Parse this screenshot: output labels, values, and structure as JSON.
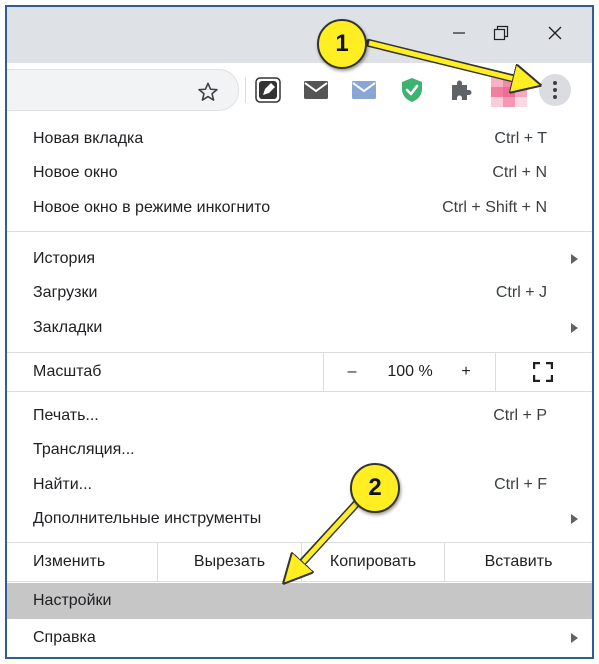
{
  "window": {
    "minimize_icon": "minimize-icon",
    "restore_icon": "restore-icon",
    "close_icon": "close-icon"
  },
  "toolbar": {
    "bookmark_icon": "star-icon",
    "extensions": [
      "pen-extension-icon",
      "gmail-dark-icon",
      "mail-blue-icon",
      "shield-check-icon",
      "puzzle-icon"
    ],
    "menu_icon": "three-dots-vertical-icon"
  },
  "menu": {
    "group1": [
      {
        "label": "Новая вкладка",
        "shortcut": "Ctrl + T"
      },
      {
        "label": "Новое окно",
        "shortcut": "Ctrl + N"
      },
      {
        "label": "Новое окно в режиме инкогнито",
        "shortcut": "Ctrl + Shift + N"
      }
    ],
    "group2": [
      {
        "label": "История",
        "shortcut": ""
      },
      {
        "label": "Загрузки",
        "shortcut": "Ctrl + J"
      },
      {
        "label": "Закладки",
        "shortcut": ""
      }
    ],
    "zoom": {
      "label": "Масштаб",
      "minus": "–",
      "value": "100 %",
      "plus": "+",
      "fullscreen_icon": "fullscreen-icon"
    },
    "group3": [
      {
        "label": "Печать...",
        "shortcut": "Ctrl + P"
      },
      {
        "label": "Трансляция...",
        "shortcut": ""
      },
      {
        "label": "Найти...",
        "shortcut": "Ctrl + F"
      },
      {
        "label": "Дополнительные инструменты",
        "shortcut": ""
      }
    ],
    "edit": {
      "label": "Изменить",
      "cut": "Вырезать",
      "copy": "Копировать",
      "paste": "Вставить"
    },
    "settings": {
      "label": "Настройки"
    },
    "help": {
      "label": "Справка"
    }
  },
  "annotations": {
    "callout1": "1",
    "callout2": "2",
    "color": "#ffee22"
  },
  "colors": {
    "highlight": "#c6c6c6",
    "frame_border": "#2f5d9a",
    "titlebar": "#dee1e6"
  }
}
